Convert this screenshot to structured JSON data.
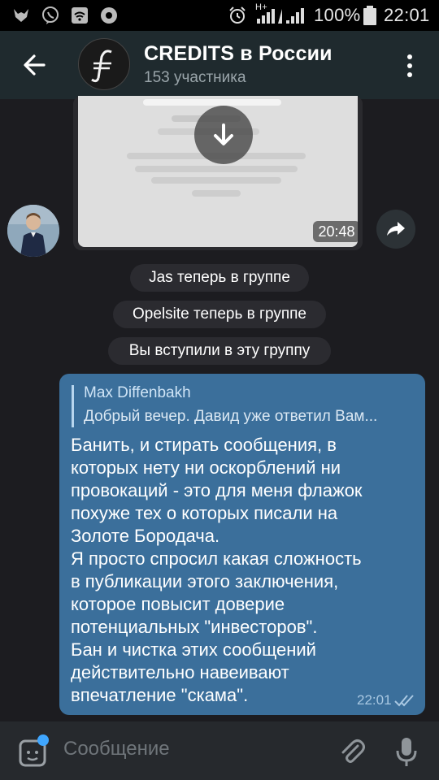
{
  "status_bar": {
    "network": "H+",
    "battery_percent": "100%",
    "time": "22:01"
  },
  "header": {
    "title": "CREDITS в России",
    "subtitle": "153 участника"
  },
  "photo_message": {
    "time": "20:48"
  },
  "system_messages": [
    "Jas теперь в группе",
    "Opelsite теперь в группе",
    "Вы вступили в эту группу"
  ],
  "message": {
    "reply_name": "Max Diffenbakh",
    "reply_text": "Добрый вечер. Давид уже ответил Вам...",
    "text": "Банить, и стирать сообщения, в\nкоторых нету ни оскорблений ни\nпровокаций - это для меня флажок\nпохуже тех о которых писали на\nЗолоте Бородача.\nЯ просто спросил какая сложность\nв публикации этого заключения,\nкоторое повысит доверие\nпотенциальных \"инвесторов\".\nБан и чистка этих сообщений\nдействительно навеивают\nвпечатление \"скама\".",
    "time": "22:01"
  },
  "composer": {
    "placeholder": "Сообщение"
  },
  "colors": {
    "app_bar": "#1f2a2e",
    "chat_bg": "#1c1c20",
    "bubble": "#3b6f9b",
    "accent_dot": "#3fa6ff"
  }
}
